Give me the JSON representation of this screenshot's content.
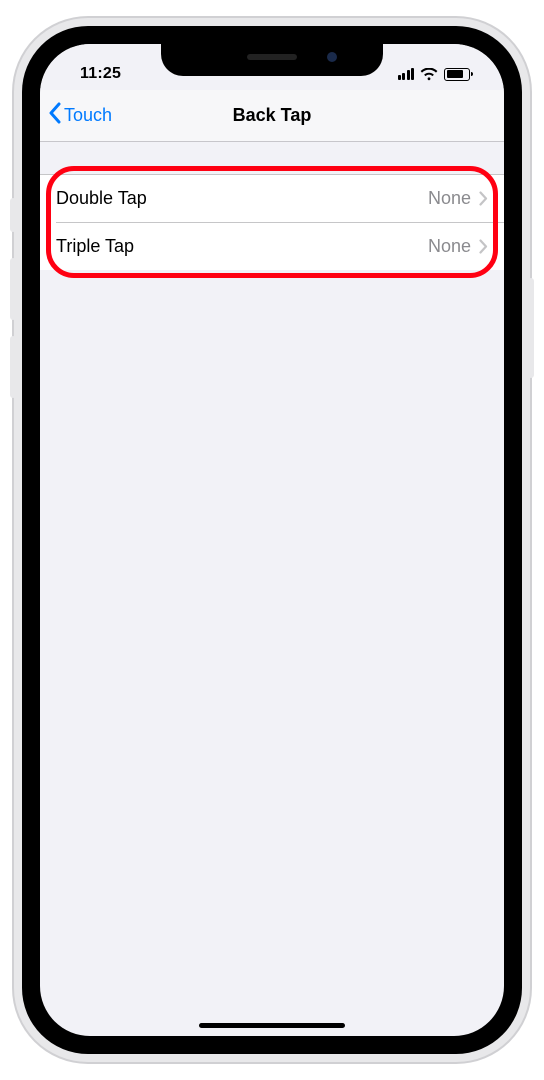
{
  "statusbar": {
    "time": "11:25"
  },
  "navbar": {
    "back_label": "Touch",
    "title": "Back Tap"
  },
  "rows": [
    {
      "label": "Double Tap",
      "value": "None"
    },
    {
      "label": "Triple Tap",
      "value": "None"
    }
  ]
}
